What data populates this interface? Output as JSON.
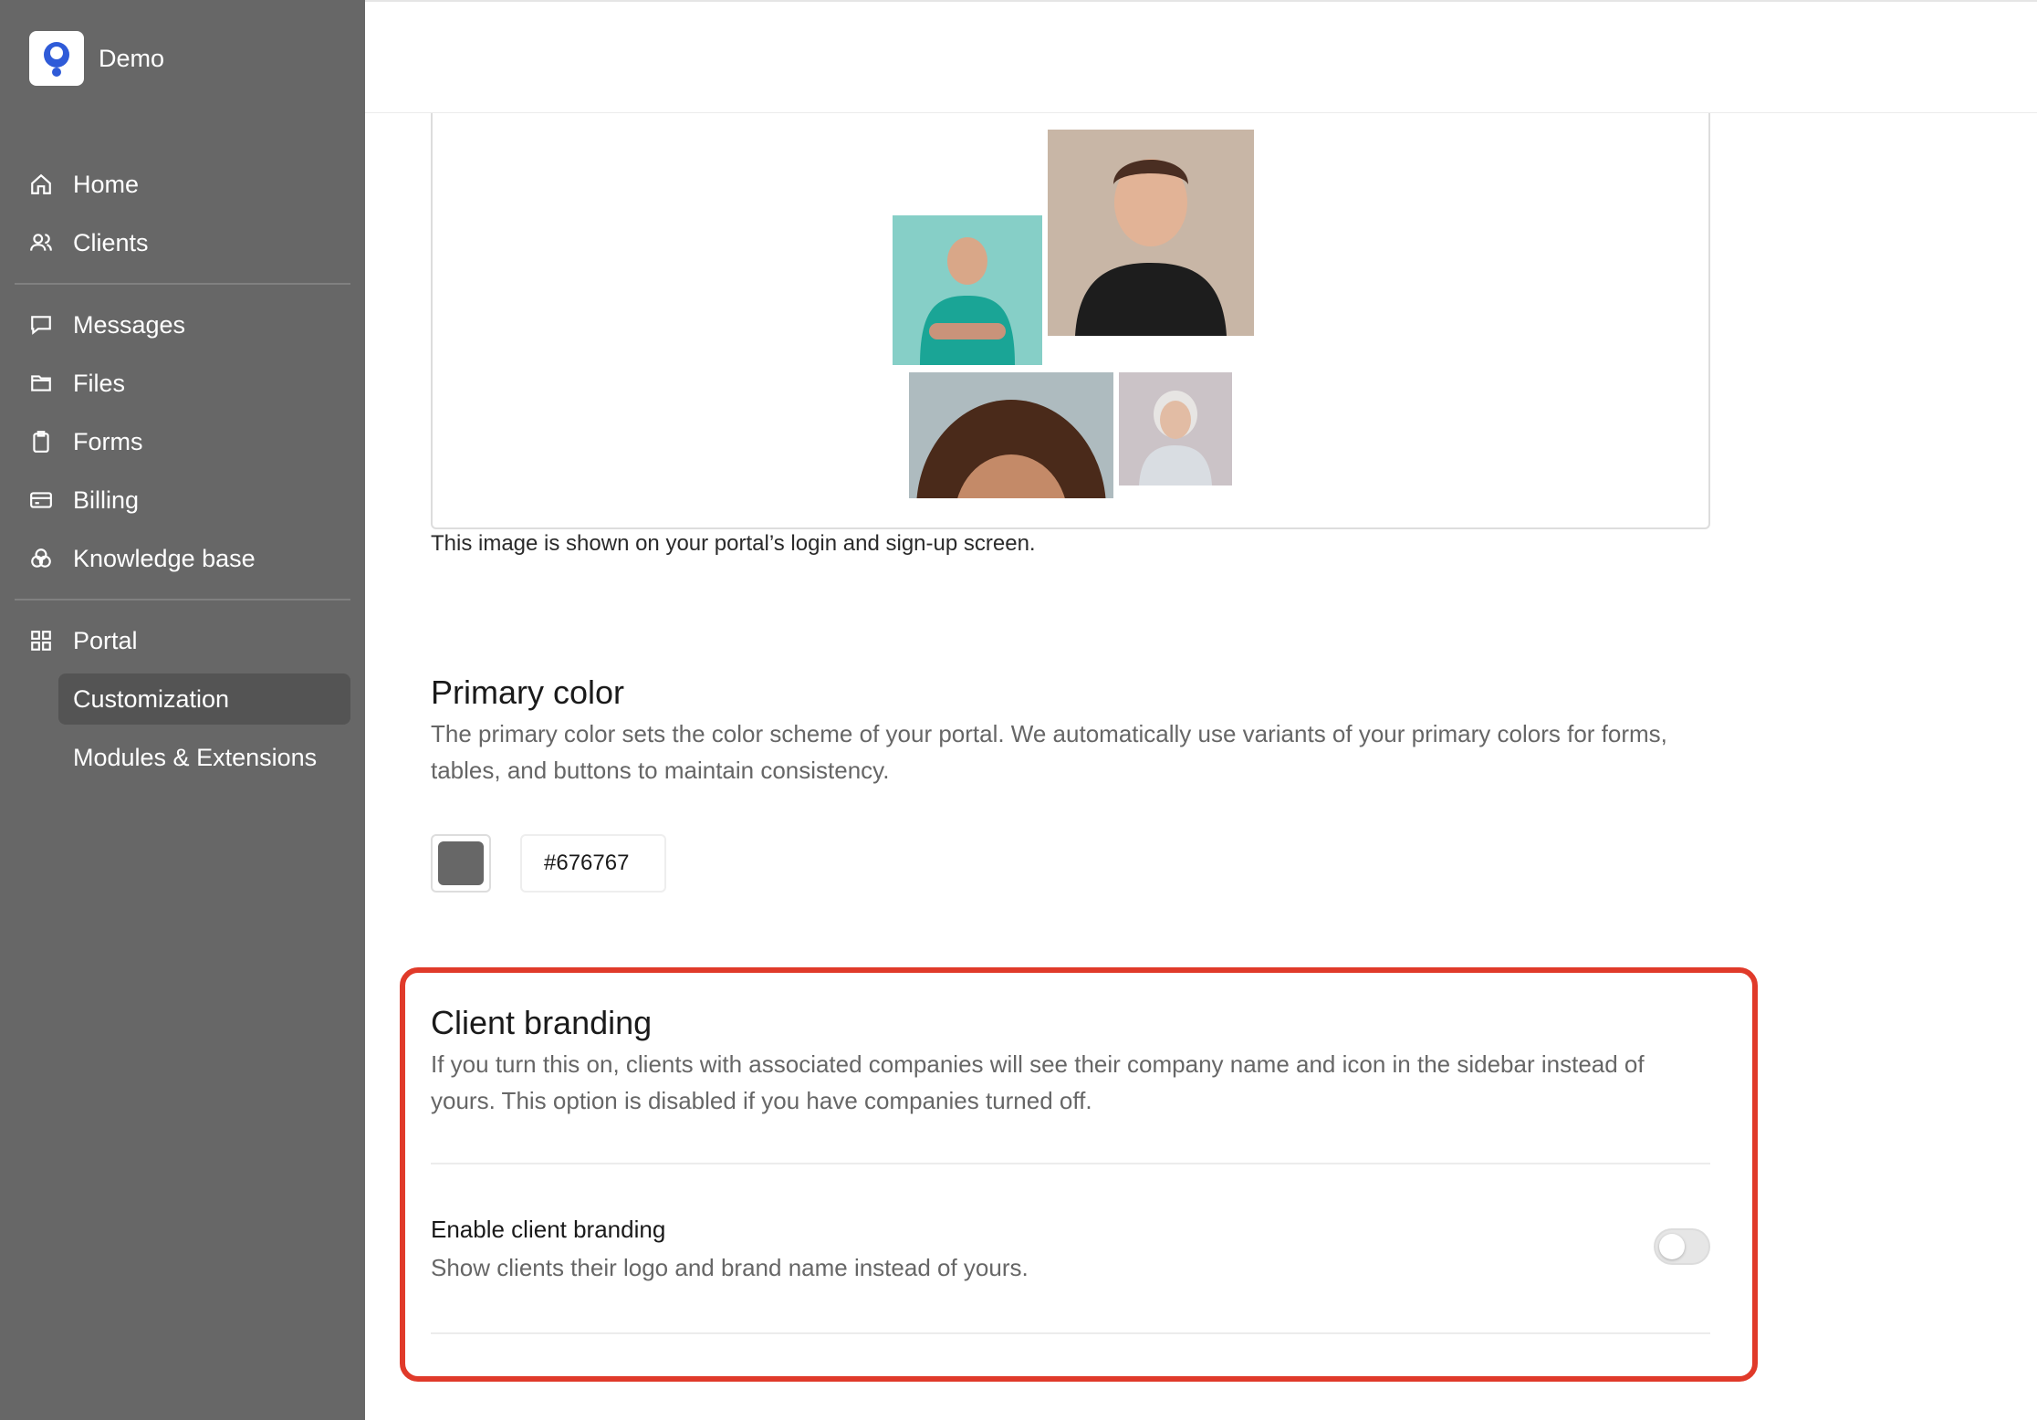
{
  "brand": {
    "name": "Demo",
    "logo_icon": "user-circle-logo-icon",
    "logo_color": "#2f5bd8"
  },
  "nav": {
    "home": "Home",
    "clients": "Clients",
    "messages": "Messages",
    "files": "Files",
    "forms": "Forms",
    "billing": "Billing",
    "knowledge_base": "Knowledge base",
    "portal": "Portal",
    "customization": "Customization",
    "modules_extensions": "Modules & Extensions"
  },
  "login_image": {
    "caption": "This image is shown on your portal’s login and sign-up screen."
  },
  "primary_color": {
    "title": "Primary color",
    "description": "The primary color sets the color scheme of your portal. We automatically use variants of your primary colors for forms, tables, and buttons to maintain consistency.",
    "value": "#676767"
  },
  "client_branding": {
    "title": "Client branding",
    "description": "If you turn this on, clients with associated companies will see their company name and icon in the sidebar instead of yours. This option is disabled if you have companies turned off.",
    "toggle_title": "Enable client branding",
    "toggle_description": "Show clients their logo and brand name instead of yours.",
    "enabled": false,
    "highlight_color": "#e03a2a"
  },
  "colors": {
    "sidebar_bg": "#676767",
    "active_item_bg": "#545454"
  }
}
